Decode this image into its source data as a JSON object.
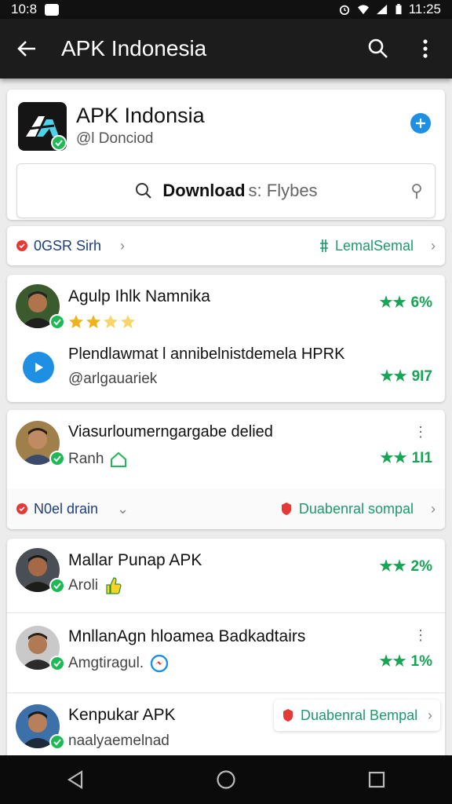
{
  "status_bar": {
    "time_left": "10:8",
    "time_right": "11:25"
  },
  "app_bar": {
    "title": "APK Indonesia"
  },
  "header_card": {
    "title": "APK Indonsia",
    "subtitle": "@l Donciod",
    "search": {
      "bold": "Download",
      "light": "s: Flybes"
    }
  },
  "strip_1": {
    "left_label": "0GSR Sirh",
    "right_label": "LemalSemal"
  },
  "card_1": {
    "rows": [
      {
        "title": "Agulp Ihlk Namnika",
        "rating": "6%"
      },
      {
        "title": "Plendlawmat l annibelnistdemela HPRK",
        "subtitle": "@arlgauariek",
        "rating": "9I7"
      }
    ]
  },
  "card_2": {
    "row": {
      "title": "Viasurloumerngargabe delied",
      "subtitle": "Ranh",
      "rating": "1I1"
    },
    "strip": {
      "left_label": "N0el drain",
      "right_label": "Duabenral sompal"
    }
  },
  "card_3": {
    "rows": [
      {
        "title": "Mallar Punap APK",
        "subtitle": "Aroli",
        "rating": "2%"
      },
      {
        "title": "MnllanAgn hloamea Badkadtairs",
        "subtitle": "Amgtiragul.",
        "rating": "1%"
      },
      {
        "title": "Kenpukar APK",
        "subtitle": "naalyaemelnad",
        "chip": "Duabenral Bempal"
      }
    ]
  },
  "colors": {
    "green": "#17a454",
    "blue": "#1e8fe3",
    "red": "#e53935",
    "teal": "#1b9a6c"
  }
}
